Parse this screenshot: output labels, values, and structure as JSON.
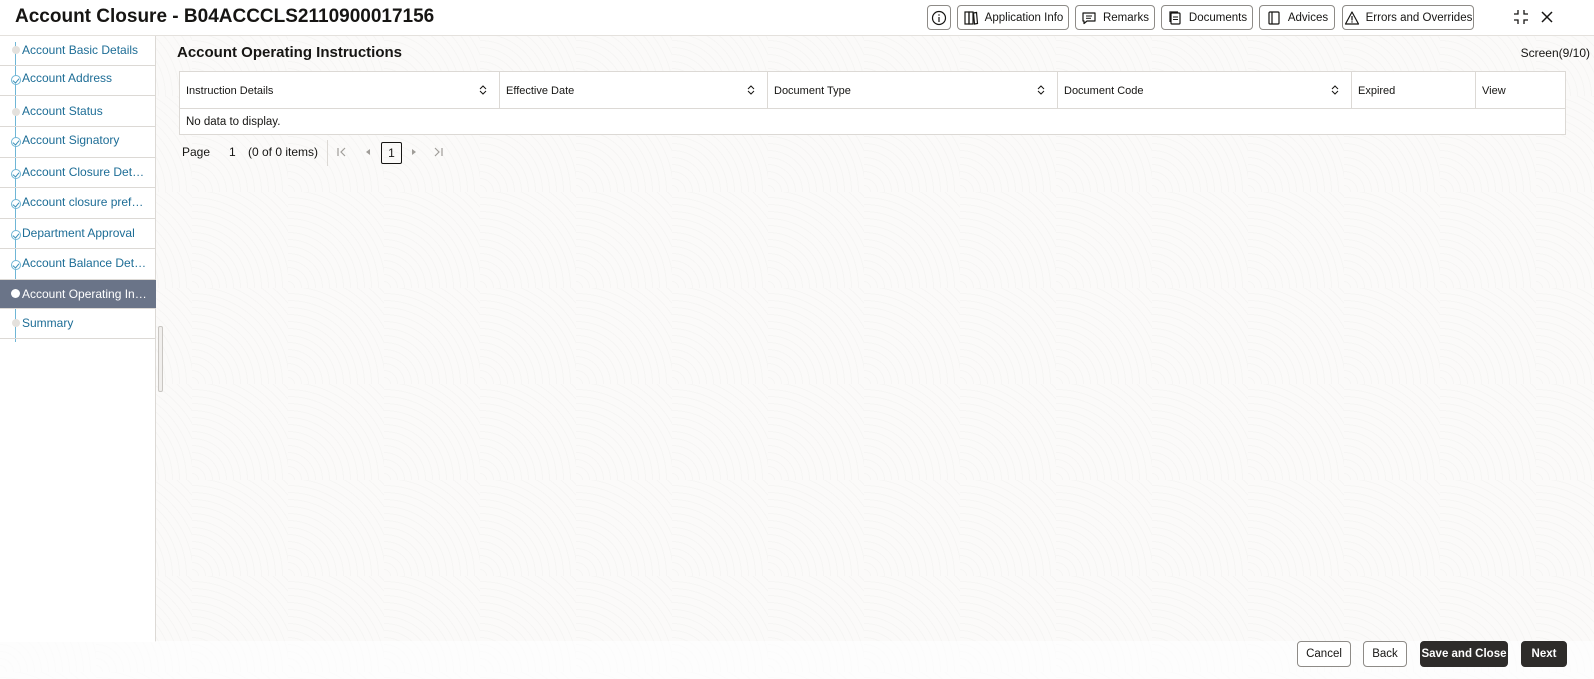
{
  "header": {
    "title": "Account Closure - B04ACCCLS2110900017156",
    "buttons": {
      "info_icon": "info-icon",
      "application_info": "Application Info",
      "remarks": "Remarks",
      "documents": "Documents",
      "advices": "Advices",
      "errors_and_overrides": "Errors and Overrides"
    }
  },
  "sidebar": {
    "items": [
      {
        "label": "Account Basic Details",
        "state": "pending"
      },
      {
        "label": "Account Address",
        "state": "done"
      },
      {
        "label": "Account Status",
        "state": "pending"
      },
      {
        "label": "Account Signatory",
        "state": "done"
      },
      {
        "label": "Account Closure Details",
        "state": "done"
      },
      {
        "label": "Account closure preferences",
        "state": "done"
      },
      {
        "label": "Department Approval",
        "state": "done"
      },
      {
        "label": "Account Balance Details",
        "state": "done"
      },
      {
        "label": "Account Operating Instructions",
        "state": "current"
      },
      {
        "label": "Summary",
        "state": "pending"
      }
    ]
  },
  "main": {
    "section_title": "Account Operating Instructions",
    "screen_count": "Screen(9/10)",
    "table": {
      "columns": [
        "Instruction Details",
        "Effective Date",
        "Document Type",
        "Document Code",
        "Expired",
        "View"
      ],
      "empty_message": "No data to display."
    },
    "pager": {
      "page_label": "Page",
      "page_value": "1",
      "items_text": "(0 of 0 items)",
      "current_page": "1"
    }
  },
  "footer": {
    "cancel": "Cancel",
    "back": "Back",
    "save_and_close": "Save and Close",
    "next": "Next"
  },
  "colors": {
    "accent_link": "#1d6d96",
    "active_nav": "#6a7488",
    "primary_button": "#2e2c2a"
  }
}
